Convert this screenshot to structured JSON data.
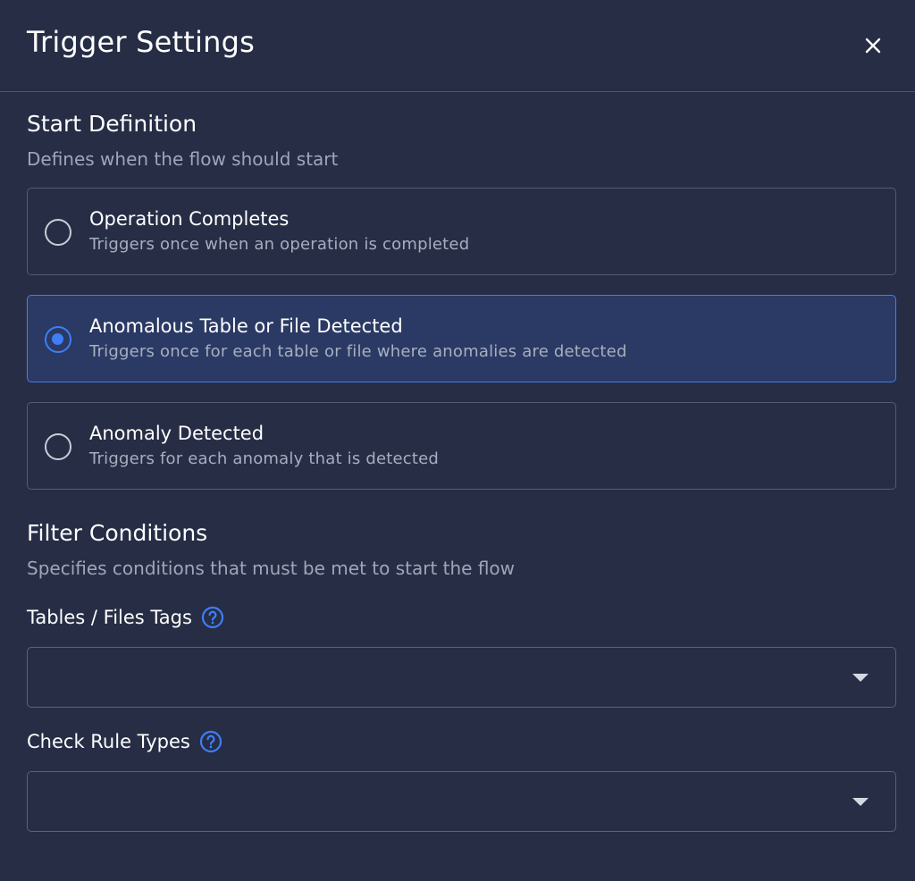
{
  "header": {
    "title": "Trigger Settings",
    "close_icon": "close-icon"
  },
  "start_definition": {
    "title": "Start Definition",
    "description": "Defines when the flow should start",
    "options": [
      {
        "label": "Operation Completes",
        "sublabel": "Triggers once when an operation is completed",
        "selected": false
      },
      {
        "label": "Anomalous Table or File Detected",
        "sublabel": "Triggers once for each table or file where anomalies are detected",
        "selected": true
      },
      {
        "label": "Anomaly Detected",
        "sublabel": "Triggers for each anomaly that is detected",
        "selected": false
      }
    ]
  },
  "filter_conditions": {
    "title": "Filter Conditions",
    "description": "Specifies conditions that must be met to start the flow",
    "fields": [
      {
        "label": "Tables / Files Tags",
        "value": "",
        "help_icon": "help-icon",
        "dropdown_icon": "caret-down-icon"
      },
      {
        "label": "Check Rule Types",
        "value": "",
        "help_icon": "help-icon",
        "dropdown_icon": "caret-down-icon"
      }
    ]
  },
  "colors": {
    "background": "#262d45",
    "accent": "#3f7ef6",
    "selected_background": "#2a3a64",
    "border": "#545c75",
    "muted_text": "#a0a6b8"
  }
}
